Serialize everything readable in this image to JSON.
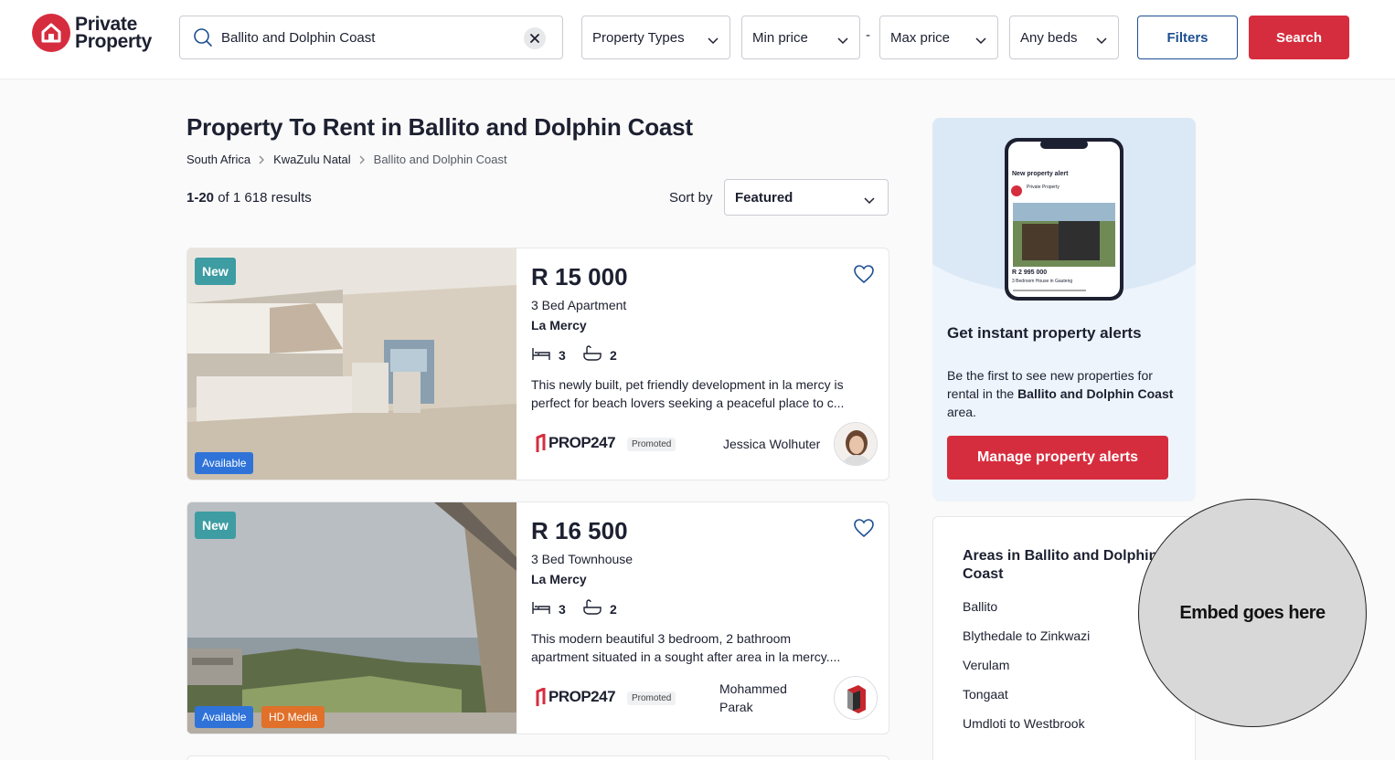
{
  "brand": {
    "line1": "Private",
    "line2": "Property",
    "color": "#d62d3e"
  },
  "search": {
    "value": "Ballito and Dolphin Coast"
  },
  "filters": {
    "property_types": "Property Types",
    "min_price": "Min price",
    "separator": "-",
    "max_price": "Max price",
    "beds": "Any beds",
    "filters_button": "Filters",
    "search_button": "Search"
  },
  "page": {
    "title": "Property To Rent in Ballito and Dolphin Coast",
    "breadcrumb": [
      "South Africa",
      "KwaZulu Natal",
      "Ballito and Dolphin Coast"
    ],
    "results_range": "1-20",
    "results_rest": " of 1 618 results",
    "sort_label": "Sort by",
    "sort_value": "Featured"
  },
  "listings": [
    {
      "badge_new": "New",
      "badge_status": "Available",
      "price": "R 15 000",
      "type": "3 Bed Apartment",
      "suburb": "La Mercy",
      "beds": "3",
      "baths": "2",
      "description_line1": "This newly built, pet friendly development in la mercy is",
      "description_line2": "perfect for beach lovers seeking a peaceful place to c...",
      "agency": "PROP247",
      "promoted": "Promoted",
      "agent_line1": "Jessica Wolhuter",
      "agent_line2": ""
    },
    {
      "badge_new": "New",
      "badge_status": "Available",
      "badge_media": "HD Media",
      "price": "R 16 500",
      "type": "3 Bed Townhouse",
      "suburb": "La Mercy",
      "beds": "3",
      "baths": "2",
      "description_line1": "This modern beautiful 3 bedroom, 2 bathroom",
      "description_line2": "apartment situated in a sought after area in la mercy....",
      "agency": "PROP247",
      "promoted": "Promoted",
      "agent_line1": "Mohammed",
      "agent_line2": "Parak"
    }
  ],
  "alert": {
    "phone_header": "New property alert",
    "phone_sender": "Private Property",
    "phone_price": "R 2 995 000",
    "phone_caption": "3 Bedroom House in Gauteng",
    "title": "Get instant property alerts",
    "body_pre": "Be the first to see new properties for rental in the ",
    "body_bold": "Ballito and Dolphin Coast",
    "body_post": " area.",
    "button": "Manage property alerts"
  },
  "areas": {
    "title": "Areas in Ballito and Dolphin Coast",
    "items": [
      "Ballito",
      "Blythedale to Zinkwazi",
      "Verulam",
      "Tongaat",
      "Umdloti to Westbrook"
    ]
  },
  "embed": {
    "label": "Embed goes here"
  },
  "colors": {
    "accent_red": "#d62d3e",
    "brand_blue": "#1d4f91",
    "new_badge": "#3e9ca3",
    "available_badge": "#2f73d9",
    "hd_badge": "#e0702a"
  }
}
